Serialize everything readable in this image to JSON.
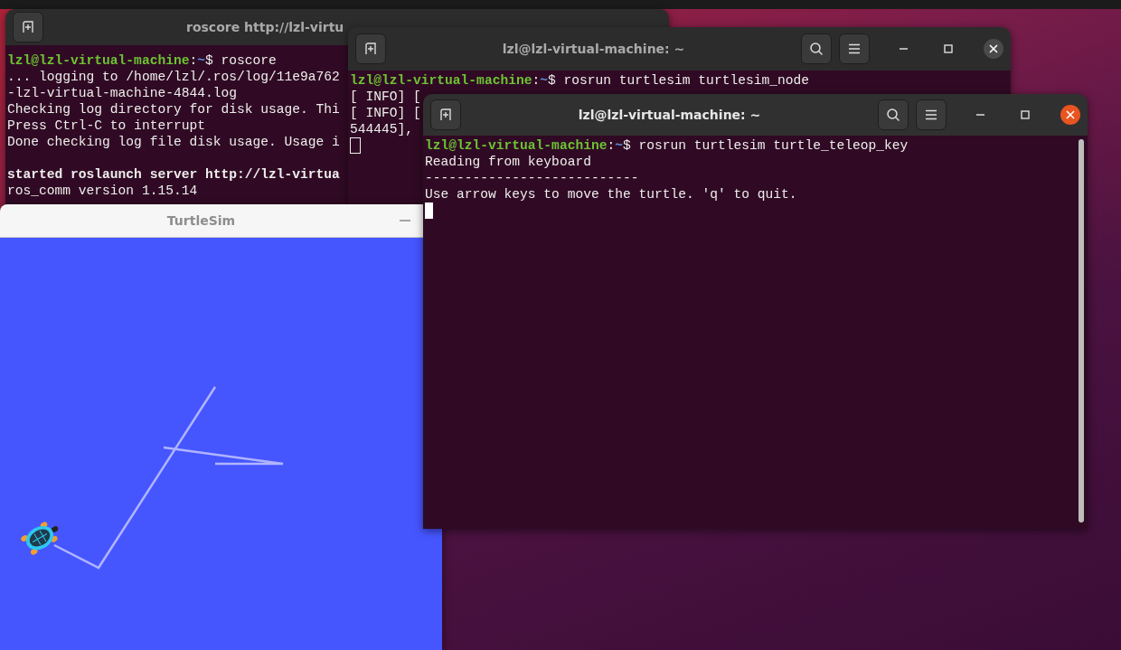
{
  "windows": [
    {
      "kind": "terminal",
      "title": "roscore http://lzl-virtu",
      "focused": false,
      "lines": [
        {
          "kind": "prompt",
          "user": "lzl@lzl-virtual-machine",
          "sep": ":",
          "path": "~",
          "command": "$ roscore"
        },
        {
          "kind": "output",
          "text": "... logging to /home/lzl/.ros/log/11e9a762"
        },
        {
          "kind": "output",
          "text": "-lzl-virtual-machine-4844.log"
        },
        {
          "kind": "output",
          "text": "Checking log directory for disk usage. Thi"
        },
        {
          "kind": "output",
          "text": "Press Ctrl-C to interrupt"
        },
        {
          "kind": "output",
          "text": "Done checking log file disk usage. Usage i"
        },
        {
          "kind": "blank"
        },
        {
          "kind": "bold",
          "text": "started roslaunch server http://lzl-virtua"
        },
        {
          "kind": "output",
          "text": "ros_comm version 1.15.14"
        }
      ]
    },
    {
      "kind": "terminal",
      "title": "lzl@lzl-virtual-machine: ~",
      "focused": false,
      "cursor": true,
      "lines": [
        {
          "kind": "prompt",
          "user": "lzl@lzl-virtual-machine",
          "sep": ":",
          "path": "~",
          "command": "$ rosrun turtlesim turtlesim_node"
        },
        {
          "kind": "output",
          "text": "[ INFO] ["
        },
        {
          "kind": "output",
          "text": "[ INFO] ["
        },
        {
          "kind": "output",
          "text": "544445],"
        }
      ]
    },
    {
      "kind": "turtlesim",
      "title": "TurtleSim",
      "focused": false
    },
    {
      "kind": "terminal",
      "title": "lzl@lzl-virtual-machine: ~",
      "focused": true,
      "cursor": true,
      "lines": [
        {
          "kind": "prompt",
          "user": "lzl@lzl-virtual-machine",
          "sep": ":",
          "path": "~",
          "command": "$ rosrun turtlesim turtle_teleop_key"
        },
        {
          "kind": "output",
          "text": "Reading from keyboard"
        },
        {
          "kind": "output",
          "text": "---------------------------"
        },
        {
          "kind": "output",
          "text": "Use arrow keys to move the turtle. 'q' to quit."
        }
      ]
    }
  ]
}
